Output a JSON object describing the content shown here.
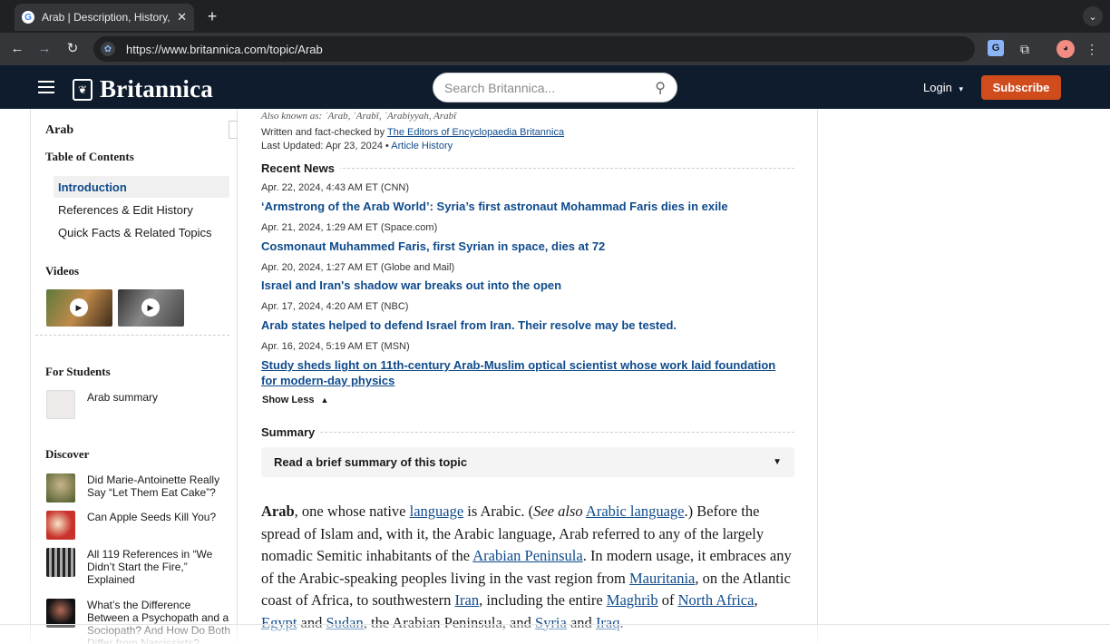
{
  "browser": {
    "tab_title": "Arab | Description, History, &",
    "tab_close": "✕",
    "new_tab": "+",
    "url": "https://www.britannica.com/topic/Arab"
  },
  "header": {
    "logo_text": "Britannica",
    "search_placeholder": "Search Britannica...",
    "login_label": "Login",
    "subscribe_label": "Subscribe"
  },
  "sidebar": {
    "title": "Arab",
    "toc_heading": "Table of Contents",
    "toc_items": [
      "Introduction",
      "References & Edit History",
      "Quick Facts & Related Topics"
    ],
    "videos_heading": "Videos",
    "students_heading": "For Students",
    "students_link": "Arab summary",
    "discover_heading": "Discover",
    "discover_items": [
      "Did Marie-Antoinette Really Say “Let Them Eat Cake”?",
      "Can Apple Seeds Kill You?",
      "All 119 References in “We Didn’t Start the Fire,” Explained",
      "What’s the Difference Between a Psychopath and a Sociopath? And How Do Both Differ from Narcissists?"
    ]
  },
  "meta": {
    "aka": "Also known as: ʿArab, ʿArabī, ʿArabiyyah, Arabī",
    "written_prefix": "Written and fact-checked by",
    "written_by": "The Editors of Encyclopaedia Britannica",
    "updated_prefix": "Last Updated: Apr 23, 2024 •",
    "article_history": "Article History"
  },
  "news": {
    "heading": "Recent News",
    "items": [
      {
        "date": "Apr. 22, 2024, 4:43 AM ET (CNN)",
        "title": "‘Armstrong of the Arab World’: Syria’s first astronaut Mohammad Faris dies in exile"
      },
      {
        "date": "Apr. 21, 2024, 1:29 AM ET (Space.com)",
        "title": "Cosmonaut Muhammed Faris, first Syrian in space, dies at 72"
      },
      {
        "date": "Apr. 20, 2024, 1:27 AM ET (Globe and Mail)",
        "title": "Israel and Iran's shadow war breaks out into the open"
      },
      {
        "date": "Apr. 17, 2024, 4:20 AM ET (NBC)",
        "title": "Arab states helped to defend Israel from Iran. Their resolve may be tested."
      },
      {
        "date": "Apr. 16, 2024, 5:19 AM ET (MSN)",
        "title": "Study sheds light on 11th-century Arab-Muslim optical scientist whose work laid foundation for modern-day physics"
      }
    ],
    "show_less": "Show Less"
  },
  "summary": {
    "heading": "Summary",
    "toggle": "Read a brief summary of this topic"
  },
  "article": {
    "w1": "Arab",
    "t1": ", one whose native ",
    "l1": "language",
    "t2": " is Arabic. (",
    "see_also": "See also",
    "t3": " ",
    "l2": "Arabic language",
    "t4": ".) Before the spread of Islam and, with it, the Arabic language, Arab referred to any of the largely nomadic Semitic inhabitants of the ",
    "l3": "Arabian Peninsula",
    "t5": ". In modern usage, it embraces any of the Arabic-speaking peoples living in the vast region from ",
    "l4": "Mauritania",
    "t6": ", on the Atlantic coast of Africa, to southwestern ",
    "l5": "Iran",
    "t7": ", including the entire ",
    "l6": "Maghrib",
    "t8": " of ",
    "l7": "North Africa",
    "t9": ", ",
    "l8": "Egypt",
    "t10": " and ",
    "l9": "Sudan",
    "t11": ", the Arabian Peninsula, and ",
    "l10": "Syria",
    "t12": " and ",
    "l11": "Iraq",
    "t13": "."
  },
  "colors": {
    "header_bg": "#0f1c2e",
    "link": "#0f4b8c",
    "subscribe": "#d04c1d"
  }
}
